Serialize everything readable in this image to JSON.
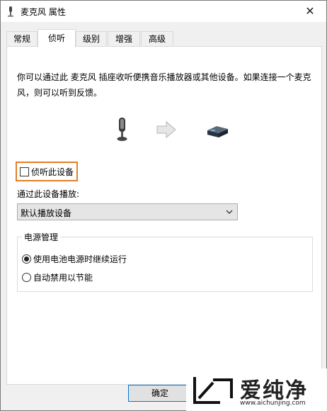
{
  "window": {
    "title": "麦克风 属性",
    "close_symbol": "✕"
  },
  "tabs": [
    {
      "label": "常规",
      "active": false
    },
    {
      "label": "侦听",
      "active": true
    },
    {
      "label": "级别",
      "active": false
    },
    {
      "label": "增强",
      "active": false
    },
    {
      "label": "高级",
      "active": false
    }
  ],
  "listen": {
    "description": "你可以通过此 麦克风 插座收听便携音乐播放器或其他设备。如果连接一个麦克风，则可以听到反馈。",
    "checkbox_label": "侦听此设备",
    "checkbox_checked": false,
    "playback_label": "通过此设备播放:",
    "playback_selected": "默认播放设备"
  },
  "power": {
    "group_title": "电源管理",
    "options": [
      {
        "label": "使用电池电源时继续运行",
        "selected": true
      },
      {
        "label": "自动禁用以节能",
        "selected": false
      }
    ]
  },
  "buttons": {
    "ok_label": "确定"
  },
  "watermark": {
    "text": "爱纯净",
    "url": "www.aichunjing.com"
  },
  "colors": {
    "highlight_border": "#e57e25",
    "ok_border": "#0078d7"
  },
  "icons": [
    "microphone-icon",
    "arrow-right-icon",
    "speaker-device-icon",
    "chevron-down-icon",
    "close-icon",
    "watermark-logo-icon"
  ]
}
